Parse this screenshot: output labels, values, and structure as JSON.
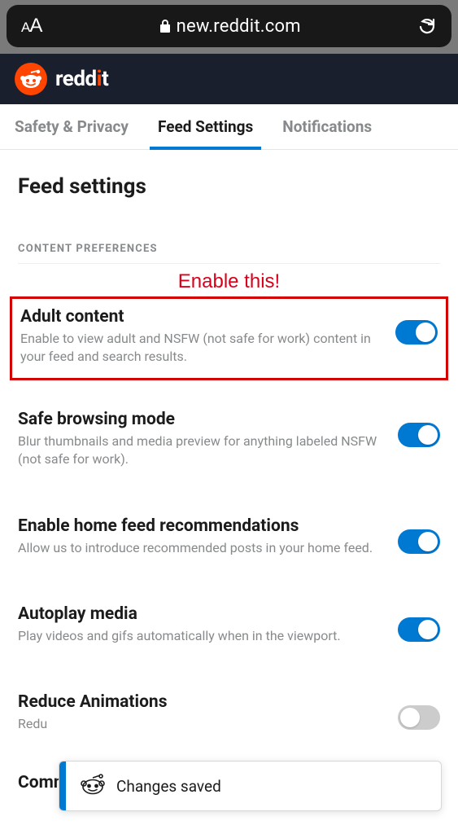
{
  "browser": {
    "url": "new.reddit.com"
  },
  "header": {
    "brand_prefix": "redd",
    "brand_i": "i",
    "brand_suffix": "t"
  },
  "tabs": {
    "safety": "Safety & Privacy",
    "feed": "Feed Settings",
    "notifications": "Notifications"
  },
  "page": {
    "title": "Feed settings",
    "section_label": "CONTENT PREFERENCES",
    "annotation": "Enable this!"
  },
  "settings": {
    "adult": {
      "title": "Adult content",
      "desc": "Enable to view adult and NSFW (not safe for work) content in your feed and search results.",
      "on": true
    },
    "safe": {
      "title": "Safe browsing mode",
      "desc": "Blur thumbnails and media preview for anything labeled NSFW (not safe for work).",
      "on": true
    },
    "recs": {
      "title": "Enable home feed recommendations",
      "desc": "Allow us to introduce recommended posts in your home feed.",
      "on": true
    },
    "autoplay": {
      "title": "Autoplay media",
      "desc": "Play videos and gifs automatically when in the viewport.",
      "on": true
    },
    "reduce": {
      "title": "Reduce Animations",
      "desc": "Redu",
      "on": false
    },
    "community": {
      "title": "Community themes"
    }
  },
  "toast": {
    "text": "Changes saved"
  }
}
